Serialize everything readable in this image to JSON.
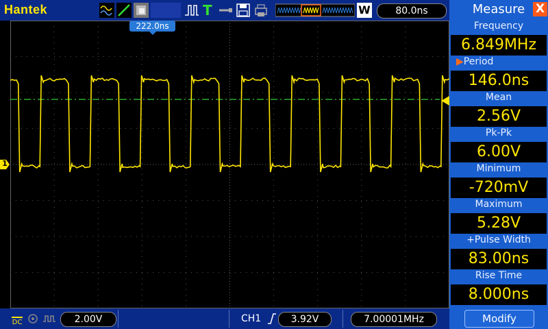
{
  "header": {
    "brand": "Hantek",
    "timebase": "80.0ns",
    "w_label": "W",
    "trigger_marker": "222.0ns",
    "trigger_mode_label": "T"
  },
  "footer": {
    "volts_div": "2.00V",
    "channel": "CH1",
    "trigger_level": "3.92V",
    "frequency": "7.00001MHz",
    "coupling_label": "DC"
  },
  "channel_marker": "1",
  "measure": {
    "title": "Measure",
    "close": "X",
    "items": [
      {
        "label": "Frequency",
        "value": "6.849MHz"
      },
      {
        "label": "Period",
        "value": "146.0ns",
        "selected": true
      },
      {
        "label": "Mean",
        "value": "2.56V"
      },
      {
        "label": "Pk-Pk",
        "value": "6.00V"
      },
      {
        "label": "Minimum",
        "value": "-720mV"
      },
      {
        "label": "Maximum",
        "value": "5.28V"
      },
      {
        "label": "+Pulse Width",
        "value": "83.00ns"
      },
      {
        "label": "Rise Time",
        "value": "8.000ns"
      }
    ],
    "modify_label": "Modify",
    "selected_arrow": "▶"
  },
  "colors": {
    "trace": "#ffe600",
    "trigger_line": "#33cc33",
    "panel": "#1a5fcf",
    "bar": "#0a2a8a"
  }
}
